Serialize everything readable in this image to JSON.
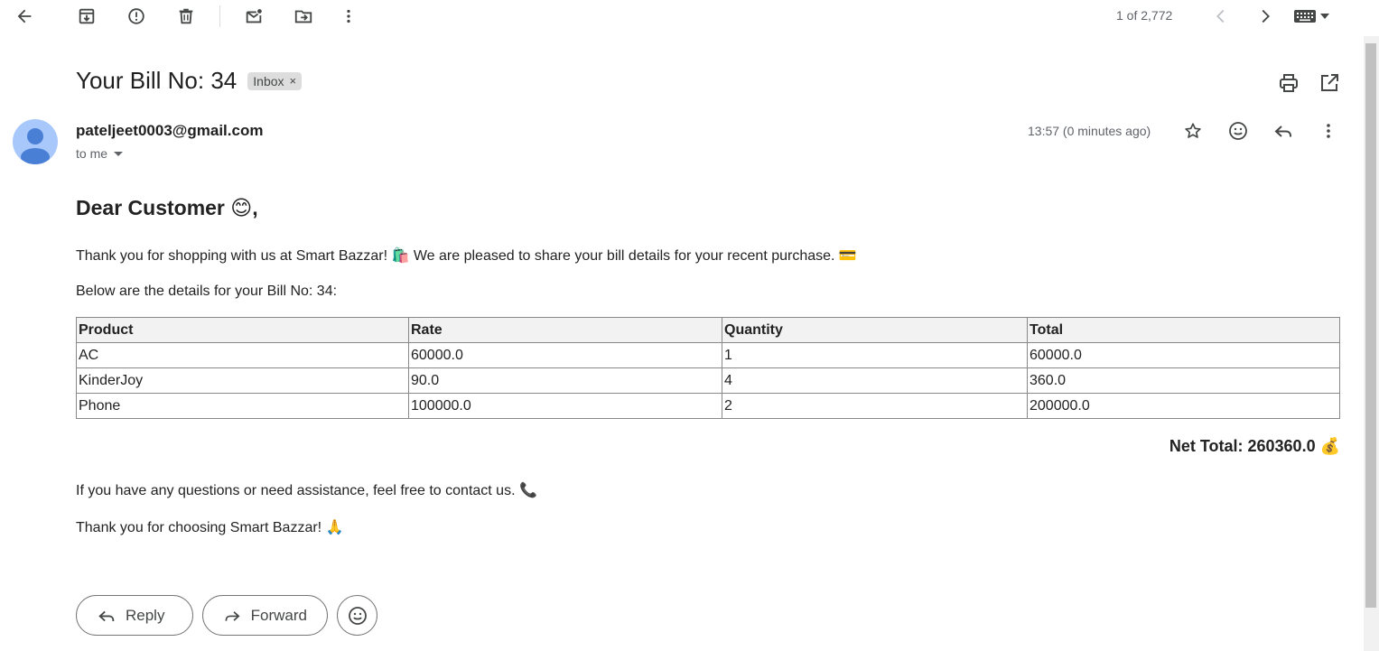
{
  "toolbar": {
    "pager_text": "1 of 2,772",
    "icons": [
      "back-arrow-icon",
      "archive-icon",
      "report-spam-icon",
      "delete-icon",
      "mark-unread-icon",
      "move-to-icon",
      "more-vert-icon",
      "chevron-left-icon",
      "chevron-right-icon",
      "keyboard-icon"
    ]
  },
  "email": {
    "subject": "Your Bill No: 34",
    "label": "Inbox",
    "label_remove": "×",
    "sender": "pateljeet0003@gmail.com",
    "to": "to me",
    "timestamp": "13:57 (0 minutes ago)"
  },
  "body": {
    "greeting": "Dear Customer 😊,",
    "intro": "Thank you for shopping with us at Smart Bazzar! 🛍️ We are pleased to share your bill details for your recent purchase. 💳",
    "details_line": "Below are the details for your Bill No: 34:",
    "table": {
      "headers": [
        "Product",
        "Rate",
        "Quantity",
        "Total"
      ],
      "rows": [
        [
          "AC",
          "60000.0",
          "1",
          "60000.0"
        ],
        [
          "KinderJoy",
          "90.0",
          "4",
          "360.0"
        ],
        [
          "Phone",
          "100000.0",
          "2",
          "200000.0"
        ]
      ]
    },
    "net_total": "Net Total: 260360.0 💰",
    "questions": "If you have any questions or need assistance, feel free to contact us. 📞",
    "closing": "Thank you for choosing Smart Bazzar! 🙏"
  },
  "actions": {
    "reply_label": "Reply",
    "forward_label": "Forward"
  },
  "colors": {
    "avatar_bg": "#a8c7fa",
    "avatar_fg": "#4a7fd6",
    "chip_bg": "#dddddd",
    "icon": "#444746"
  }
}
